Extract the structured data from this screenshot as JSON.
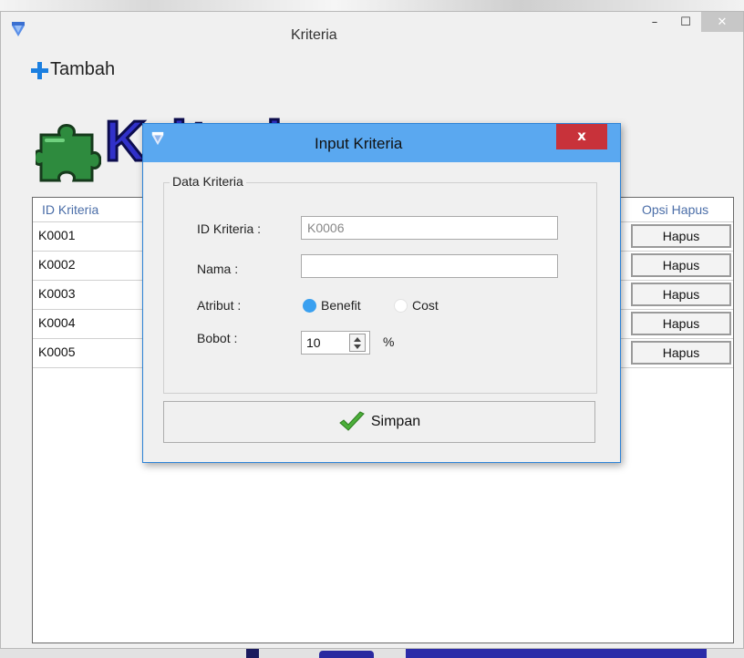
{
  "main_window": {
    "title": "Kriteria",
    "add_label": "Tambah",
    "heading_text": "Kriteria"
  },
  "window_controls": {
    "minimize": "–",
    "maximize": "☐",
    "close": "✕"
  },
  "grid": {
    "col_id": "ID Kriteria",
    "col_delete": "Opsi Hapus",
    "rows": [
      {
        "id": "K0001",
        "action": "Hapus"
      },
      {
        "id": "K0002",
        "action": "Hapus"
      },
      {
        "id": "K0003",
        "action": "Hapus"
      },
      {
        "id": "K0004",
        "action": "Hapus"
      },
      {
        "id": "K0005",
        "action": "Hapus"
      }
    ]
  },
  "dialog": {
    "title": "Input Kriteria",
    "close": "x",
    "group_title": "Data Kriteria",
    "id_label": "ID Kriteria :",
    "id_value": "K0006",
    "name_label": "Nama :",
    "name_value": "",
    "attr_label": "Atribut :",
    "attr_benefit": "Benefit",
    "attr_cost": "Cost",
    "attr_selected": "Benefit",
    "weight_label": "Bobot :",
    "weight_value": "10",
    "weight_unit": "%",
    "save_label": "Simpan"
  },
  "colors": {
    "dialog_titlebar": "#5aa8f0",
    "dialog_close": "#c8323a",
    "heading_blue": "#3131c9",
    "puzzle_green": "#2e8b3e",
    "plus_blue": "#1b7fe0",
    "radio_selected": "#3aa0f0"
  },
  "icons": {
    "app": "app-diamond-icon",
    "add": "plus-icon",
    "heading": "puzzle-icon",
    "save": "checkmark-icon"
  }
}
